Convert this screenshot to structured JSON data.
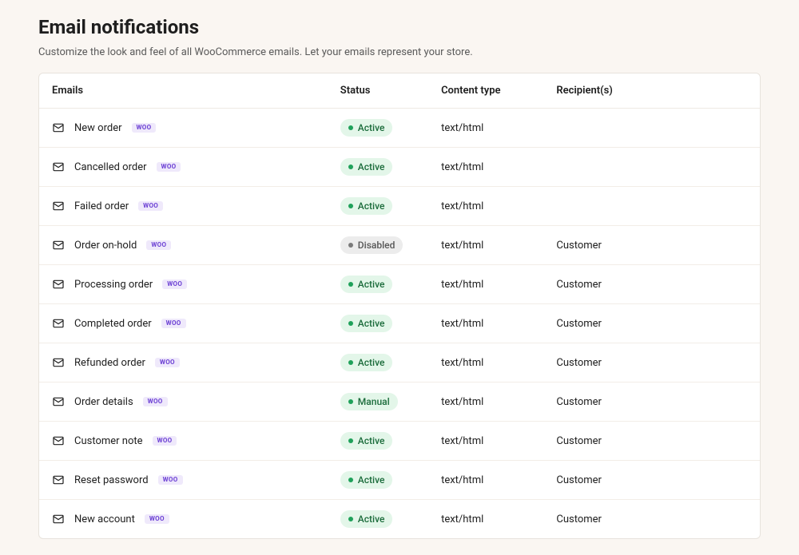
{
  "header": {
    "title": "Email notifications",
    "subtitle": "Customize the look and feel of all WooCommerce emails. Let your emails represent your store."
  },
  "columns": {
    "emails": "Emails",
    "status": "Status",
    "content_type": "Content type",
    "recipients": "Recipient(s)"
  },
  "badge_label": "WOO",
  "status_labels": {
    "active": "Active",
    "disabled": "Disabled",
    "manual": "Manual"
  },
  "rows": [
    {
      "name": "New order",
      "status": "active",
      "content_type": "text/html",
      "recipients": ""
    },
    {
      "name": "Cancelled order",
      "status": "active",
      "content_type": "text/html",
      "recipients": ""
    },
    {
      "name": "Failed order",
      "status": "active",
      "content_type": "text/html",
      "recipients": ""
    },
    {
      "name": "Order on-hold",
      "status": "disabled",
      "content_type": "text/html",
      "recipients": "Customer"
    },
    {
      "name": "Processing order",
      "status": "active",
      "content_type": "text/html",
      "recipients": "Customer"
    },
    {
      "name": "Completed order",
      "status": "active",
      "content_type": "text/html",
      "recipients": "Customer"
    },
    {
      "name": "Refunded order",
      "status": "active",
      "content_type": "text/html",
      "recipients": "Customer"
    },
    {
      "name": "Order details",
      "status": "manual",
      "content_type": "text/html",
      "recipients": "Customer"
    },
    {
      "name": "Customer note",
      "status": "active",
      "content_type": "text/html",
      "recipients": "Customer"
    },
    {
      "name": "Reset password",
      "status": "active",
      "content_type": "text/html",
      "recipients": "Customer"
    },
    {
      "name": "New account",
      "status": "active",
      "content_type": "text/html",
      "recipients": "Customer"
    }
  ]
}
